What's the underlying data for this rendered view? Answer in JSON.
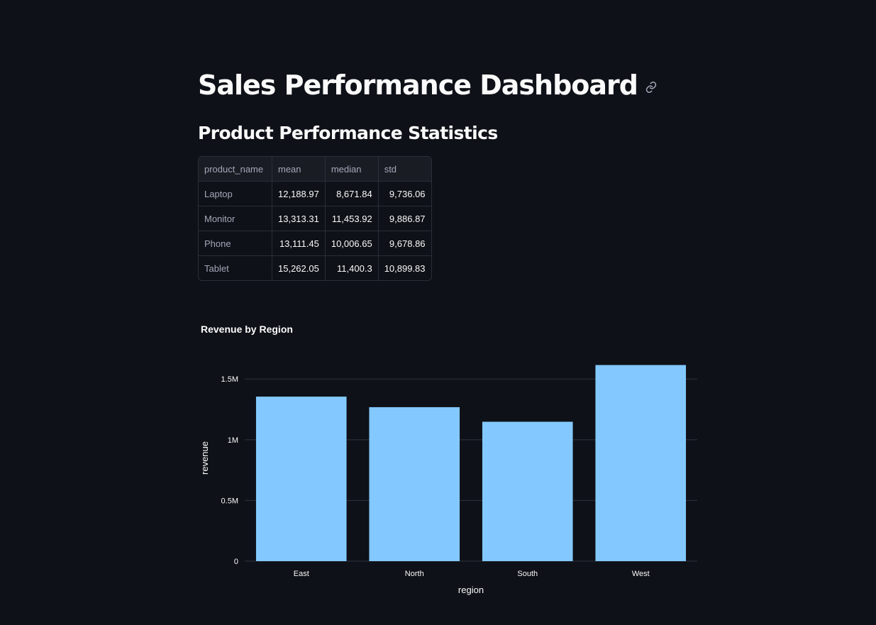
{
  "page": {
    "title": "Sales Performance Dashboard",
    "link_icon": "link-icon"
  },
  "stats": {
    "heading": "Product Performance Statistics",
    "columns": [
      "product_name",
      "mean",
      "median",
      "std"
    ],
    "rows": [
      [
        "Laptop",
        "12,188.97",
        "8,671.84",
        "9,736.06"
      ],
      [
        "Monitor",
        "13,313.31",
        "11,453.92",
        "9,886.87"
      ],
      [
        "Phone",
        "13,111.45",
        "10,006.65",
        "9,678.86"
      ],
      [
        "Tablet",
        "15,262.05",
        "11,400.3",
        "10,899.83"
      ]
    ]
  },
  "chart_data": {
    "type": "bar",
    "title": "Revenue by Region",
    "xlabel": "region",
    "ylabel": "revenue",
    "categories": [
      "East",
      "North",
      "South",
      "West"
    ],
    "values": [
      1355000,
      1268000,
      1148000,
      1615000
    ],
    "ylim": [
      0,
      1700000
    ],
    "yticks": [
      0,
      500000,
      1000000,
      1500000
    ],
    "ytick_labels": [
      "0",
      "0.5M",
      "1M",
      "1.5M"
    ],
    "grid": true,
    "bar_color": "#83c9ff"
  },
  "colors": {
    "background": "#0e1117",
    "text": "#fafafa",
    "muted_text": "#a3a8b8",
    "grid": "#31333f"
  }
}
